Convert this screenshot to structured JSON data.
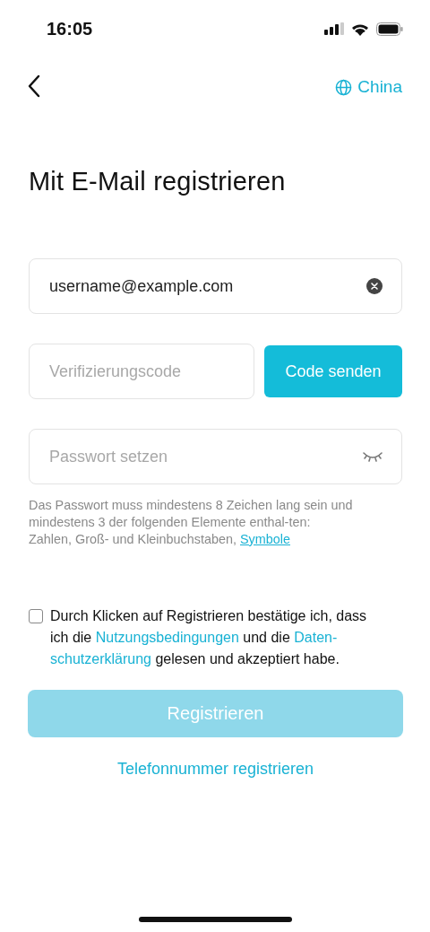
{
  "status_bar": {
    "time": "16:05"
  },
  "header": {
    "region": "China"
  },
  "title": "Mit E-Mail registrieren",
  "email": {
    "value": "username@example.com"
  },
  "code": {
    "placeholder": "Verifizierungscode",
    "button": "Code senden"
  },
  "password": {
    "placeholder": "Passwort setzen"
  },
  "hint": {
    "text": "Das Passwort muss mindestens 8 Zeichen lang sein und mindestens 3 der folgenden Elemente enthal-ten: Zahlen, Groß- und Kleinbuchstaben, ",
    "link": "Symbole"
  },
  "agreement": {
    "checked": false,
    "parts": [
      {
        "kind": "text",
        "text": "Durch Klicken auf Registrieren bestätige ich, dass ich die "
      },
      {
        "kind": "link",
        "text": "Nutzungsbedingungen"
      },
      {
        "kind": "text",
        "text": " und die "
      },
      {
        "kind": "link",
        "text": "Daten-schutzerklärung"
      },
      {
        "kind": "text",
        "text": " gelesen und akzeptiert habe."
      }
    ]
  },
  "register_button": {
    "label": "Registrieren",
    "disabled": true
  },
  "alt_link": "Telefonnummer registrieren"
}
